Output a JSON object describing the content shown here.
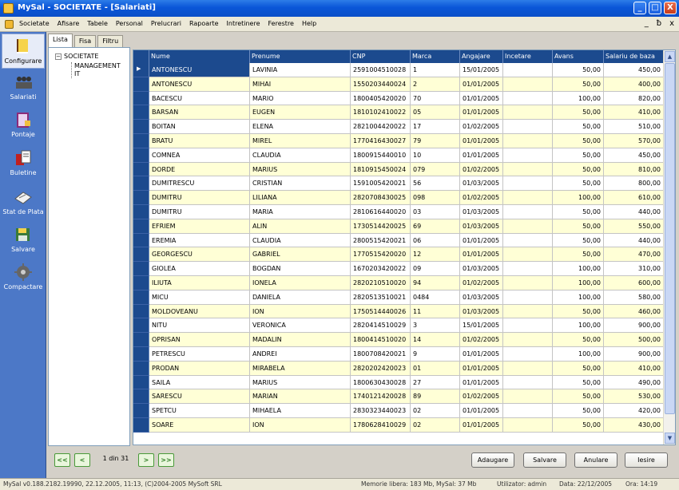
{
  "window": {
    "title": "MySal - SOCIETATE - [Salariati]",
    "minimize": "_",
    "maximize": "□",
    "close": "X"
  },
  "menu": {
    "items": [
      "Societate",
      "Afisare",
      "Tabele",
      "Personal",
      "Prelucrari",
      "Rapoarte",
      "Intretinere",
      "Ferestre",
      "Help"
    ],
    "right_controls": [
      "_",
      "ƀ",
      "x"
    ]
  },
  "toolbar": {
    "items": [
      {
        "label": "Configurare",
        "icon": "book-icon"
      },
      {
        "label": "Salariati",
        "icon": "people-icon"
      },
      {
        "label": "Pontaje",
        "icon": "clipboard-icon"
      },
      {
        "label": "Buletine",
        "icon": "documents-icon"
      },
      {
        "label": "Stat de Plata",
        "icon": "ledger-icon"
      },
      {
        "label": "Salvare",
        "icon": "disk-icon"
      },
      {
        "label": "Compactare",
        "icon": "gear-icon"
      }
    ]
  },
  "tree": {
    "tabs": [
      "Lista",
      "Fisa",
      "Filtru"
    ],
    "root": "SOCIETATE",
    "expander": "−",
    "children": [
      "MANAGEMENT",
      "IT"
    ]
  },
  "grid": {
    "indicator": "▶",
    "columns": [
      "Nume",
      "Prenume",
      "CNP",
      "Marca",
      "Angajare",
      "Incetare",
      "Avans",
      "Salariu de baza"
    ],
    "rows": [
      [
        "ANTONESCU",
        "LAVINIA",
        "2591004510028",
        "1",
        "15/01/2005",
        "",
        "50,00",
        "450,00"
      ],
      [
        "ANTONESCU",
        "MIHAI",
        "1550203440024",
        "2",
        "01/01/2005",
        "",
        "50,00",
        "400,00"
      ],
      [
        "BACESCU",
        "MARIO",
        "1800405420020",
        "70",
        "01/01/2005",
        "",
        "100,00",
        "820,00"
      ],
      [
        "BARSAN",
        "EUGEN",
        "1810102410022",
        "05",
        "01/01/2005",
        "",
        "50,00",
        "410,00"
      ],
      [
        "BOITAN",
        "ELENA",
        "2821004420022",
        "17",
        "01/02/2005",
        "",
        "50,00",
        "510,00"
      ],
      [
        "BRATU",
        "MIREL",
        "1770416430027",
        "79",
        "01/01/2005",
        "",
        "50,00",
        "570,00"
      ],
      [
        "COMNEA",
        "CLAUDIA",
        "1800915440010",
        "10",
        "01/01/2005",
        "",
        "50,00",
        "450,00"
      ],
      [
        "DORDE",
        "MARIUS",
        "1810915450024",
        "079",
        "01/02/2005",
        "",
        "50,00",
        "810,00"
      ],
      [
        "DUMITRESCU",
        "CRISTIAN",
        "1591005420021",
        "56",
        "01/03/2005",
        "",
        "50,00",
        "800,00"
      ],
      [
        "DUMITRU",
        "LILIANA",
        "2820708430025",
        "098",
        "01/02/2005",
        "",
        "100,00",
        "610,00"
      ],
      [
        "DUMITRU",
        "MARIA",
        "2810616440020",
        "03",
        "01/03/2005",
        "",
        "50,00",
        "440,00"
      ],
      [
        "EFRIEM",
        "ALIN",
        "1730514420025",
        "69",
        "01/03/2005",
        "",
        "50,00",
        "550,00"
      ],
      [
        "EREMIA",
        "CLAUDIA",
        "2800515420021",
        "06",
        "01/01/2005",
        "",
        "50,00",
        "440,00"
      ],
      [
        "GEORGESCU",
        "GABRIEL",
        "1770515420020",
        "12",
        "01/01/2005",
        "",
        "50,00",
        "470,00"
      ],
      [
        "GIOLEA",
        "BOGDAN",
        "1670203420022",
        "09",
        "01/03/2005",
        "",
        "100,00",
        "310,00"
      ],
      [
        "ILIUTA",
        "IONELA",
        "2820210510020",
        "94",
        "01/02/2005",
        "",
        "100,00",
        "600,00"
      ],
      [
        "MICU",
        "DANIELA",
        "2820513510021",
        "0484",
        "01/03/2005",
        "",
        "100,00",
        "580,00"
      ],
      [
        "MOLDOVEANU",
        "ION",
        "1750514440026",
        "11",
        "01/03/2005",
        "",
        "50,00",
        "460,00"
      ],
      [
        "NITU",
        "VERONICA",
        "2820414510029",
        "3",
        "15/01/2005",
        "",
        "100,00",
        "900,00"
      ],
      [
        "OPRISAN",
        "MADALIN",
        "1800414510020",
        "14",
        "01/02/2005",
        "",
        "50,00",
        "500,00"
      ],
      [
        "PETRESCU",
        "ANDREI",
        "1800708420021",
        "9",
        "01/01/2005",
        "",
        "100,00",
        "900,00"
      ],
      [
        "PRODAN",
        "MIRABELA",
        "2820202420023",
        "01",
        "01/01/2005",
        "",
        "50,00",
        "410,00"
      ],
      [
        "SAILA",
        "MARIUS",
        "1800630430028",
        "27",
        "01/01/2005",
        "",
        "50,00",
        "490,00"
      ],
      [
        "SARESCU",
        "MARIAN",
        "1740121420028",
        "89",
        "01/02/2005",
        "",
        "50,00",
        "530,00"
      ],
      [
        "SPETCU",
        "MIHAELA",
        "2830323440023",
        "02",
        "01/01/2005",
        "",
        "50,00",
        "420,00"
      ],
      [
        "SOARE",
        "ION",
        "1780628410029",
        "02",
        "01/01/2005",
        "",
        "50,00",
        "430,00"
      ]
    ],
    "scroll_up": "▲",
    "scroll_down": "▼"
  },
  "navigation": {
    "first": "<<",
    "prev": "<",
    "page": "1 din 31",
    "next": ">",
    "last": ">>"
  },
  "actions": {
    "add": "Adaugare",
    "save": "Salvare",
    "cancel": "Anulare",
    "exit": "Iesire"
  },
  "status": {
    "version": "MySal v0.188.2182.19990, 22.12.2005, 11:13, (C)2004-2005 MySoft SRL",
    "memory": "Memorie libera: 183 Mb, MySal: 37 Mb",
    "user": "Utilizator: admin",
    "date": "Data: 22/12/2005",
    "time": "Ora: 14:19"
  },
  "colors": {
    "titlebar": "#0a56d8",
    "grid_header": "#1c4a8e",
    "row_alt": "#ffffd6",
    "toolbar": "#4c78c7"
  }
}
